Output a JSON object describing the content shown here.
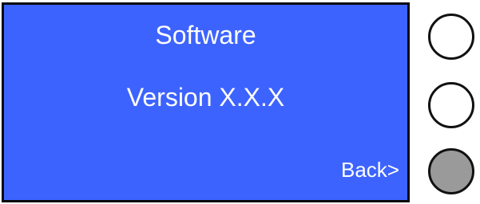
{
  "screen": {
    "title": "Software",
    "version": "Version X.X.X",
    "back_label": "Back>"
  },
  "buttons": [
    {
      "name": "top",
      "color": "#ffffff"
    },
    {
      "name": "middle",
      "color": "#ffffff"
    },
    {
      "name": "bottom",
      "color": "#9a9a9a"
    }
  ],
  "colors": {
    "screen_background": "#3d63ff",
    "screen_text": "#ffffff"
  }
}
